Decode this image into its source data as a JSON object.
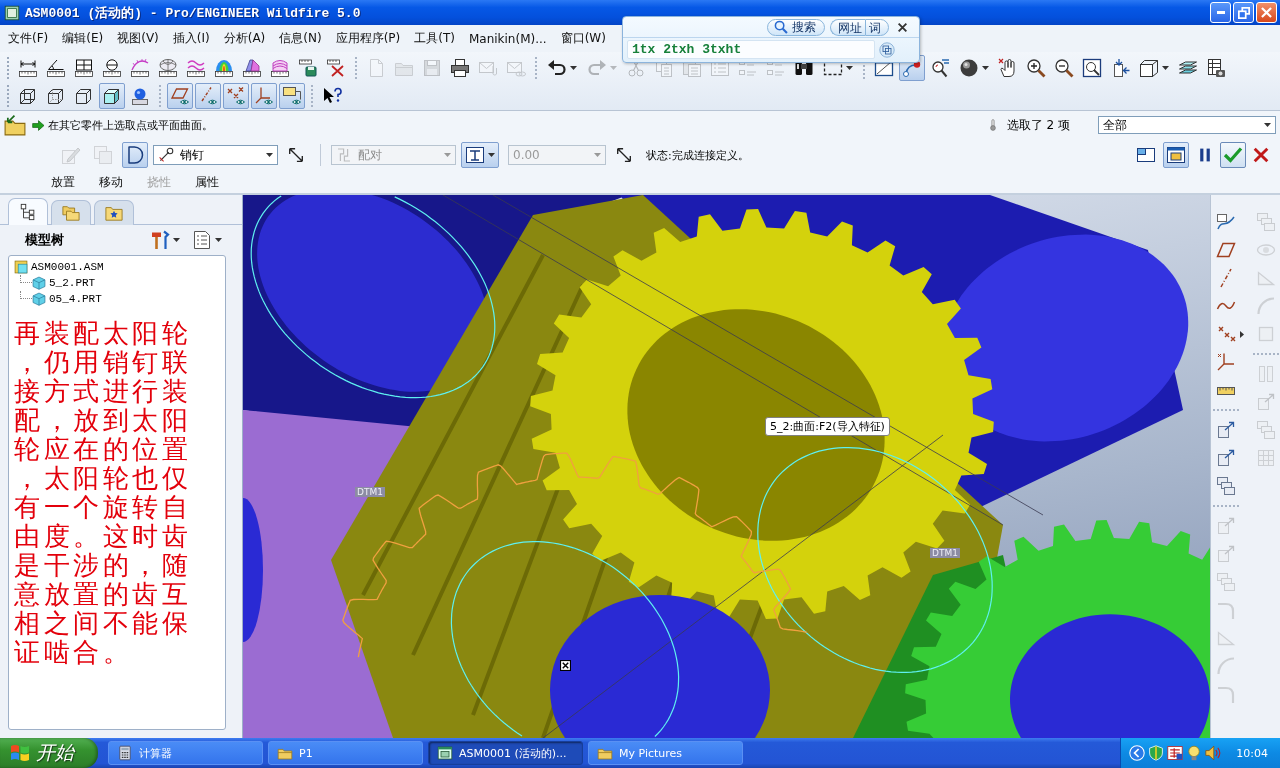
{
  "window": {
    "title": "ASM0001 (活动的) - Pro/ENGINEER Wildfire 5.0"
  },
  "menu": [
    "文件(F)",
    "编辑(E)",
    "视图(V)",
    "插入(I)",
    "分析(A)",
    "信息(N)",
    "应用程序(P)",
    "工具(T)",
    "Manikin(M)...",
    "窗口(W)"
  ],
  "search_popup": {
    "buttons": [
      "搜索",
      "网址",
      "词"
    ],
    "value": "1tx 2txh 3txht"
  },
  "toolbar": {
    "rows": [
      [
        [
          {
            "kind": "span",
            "on": false,
            "disabled": false,
            "dropdown": false
          },
          {
            "kind": "angle",
            "on": false,
            "disabled": false,
            "dropdown": false
          },
          {
            "kind": "area",
            "on": false,
            "disabled": false,
            "dropdown": false
          },
          {
            "kind": "diameter",
            "on": false,
            "disabled": false,
            "dropdown": false
          },
          {
            "kind": "comb",
            "on": false,
            "disabled": false,
            "dropdown": false
          },
          {
            "kind": "mesh",
            "on": false,
            "disabled": false,
            "dropdown": false
          },
          {
            "kind": "wave",
            "on": false,
            "disabled": false,
            "dropdown": false
          },
          {
            "kind": "dome",
            "on": false,
            "disabled": false,
            "dropdown": false
          },
          {
            "kind": "draft",
            "on": false,
            "disabled": false,
            "dropdown": false
          },
          {
            "kind": "stripes",
            "on": false,
            "disabled": false,
            "dropdown": false
          },
          {
            "kind": "rulerdisk",
            "on": false,
            "disabled": false,
            "dropdown": false
          },
          {
            "kind": "rulercross",
            "on": false,
            "disabled": false,
            "dropdown": false
          }
        ],
        [
          {
            "kind": "page",
            "on": false,
            "disabled": true,
            "dropdown": false
          },
          {
            "kind": "folder",
            "on": false,
            "disabled": true,
            "dropdown": false
          },
          {
            "kind": "floppy",
            "on": false,
            "disabled": true,
            "dropdown": false
          },
          {
            "kind": "printer",
            "on": false,
            "disabled": false,
            "dropdown": false
          },
          {
            "kind": "mail",
            "on": false,
            "disabled": true,
            "dropdown": false
          },
          {
            "kind": "maillink",
            "on": false,
            "disabled": true,
            "dropdown": false
          }
        ],
        [
          {
            "kind": "undo",
            "on": false,
            "disabled": false,
            "dropdown": true
          },
          {
            "kind": "redo",
            "on": false,
            "disabled": true,
            "dropdown": true
          },
          {
            "kind": "scissors",
            "on": false,
            "disabled": true,
            "dropdown": false
          },
          {
            "kind": "copy",
            "on": false,
            "disabled": true,
            "dropdown": false
          },
          {
            "kind": "paste",
            "on": false,
            "disabled": true,
            "dropdown": false
          },
          {
            "kind": "list",
            "on": false,
            "disabled": true,
            "dropdown": false
          },
          {
            "kind": "outline",
            "on": false,
            "disabled": true,
            "dropdown": false
          },
          {
            "kind": "outline",
            "on": false,
            "disabled": true,
            "dropdown": false
          },
          {
            "kind": "binoculars",
            "on": false,
            "disabled": false,
            "dropdown": false
          },
          {
            "kind": "marquee",
            "on": false,
            "disabled": false,
            "dropdown": true
          }
        ],
        [
          {
            "kind": "repaint",
            "on": false,
            "disabled": false,
            "dropdown": false
          },
          {
            "kind": "spin",
            "on": true,
            "disabled": false,
            "dropdown": false
          },
          {
            "kind": "orient",
            "on": false,
            "disabled": false,
            "dropdown": false
          },
          {
            "kind": "sphere",
            "on": false,
            "disabled": false,
            "dropdown": true
          },
          {
            "kind": "pan",
            "on": false,
            "disabled": false,
            "dropdown": false
          },
          {
            "kind": "zoomin",
            "on": false,
            "disabled": false,
            "dropdown": false
          },
          {
            "kind": "zoomout",
            "on": false,
            "disabled": false,
            "dropdown": false
          },
          {
            "kind": "refit",
            "on": false,
            "disabled": false,
            "dropdown": false
          },
          {
            "kind": "reorient",
            "on": false,
            "disabled": false,
            "dropdown": false
          },
          {
            "kind": "views",
            "on": false,
            "disabled": false,
            "dropdown": true
          },
          {
            "kind": "layers",
            "on": false,
            "disabled": false,
            "dropdown": false
          },
          {
            "kind": "setup",
            "on": false,
            "disabled": false,
            "dropdown": false
          }
        ]
      ],
      [
        [
          {
            "kind": "wireframe",
            "on": false,
            "disabled": false,
            "dropdown": false
          },
          {
            "kind": "hidden",
            "on": false,
            "disabled": false,
            "dropdown": false
          },
          {
            "kind": "nohidden",
            "on": false,
            "disabled": false,
            "dropdown": false
          },
          {
            "kind": "shaded",
            "on": true,
            "disabled": false,
            "dropdown": false
          },
          {
            "kind": "realism",
            "on": false,
            "disabled": false,
            "dropdown": false
          }
        ],
        [
          {
            "kind": "planes",
            "on": true,
            "disabled": false,
            "dropdown": false
          },
          {
            "kind": "axes",
            "on": true,
            "disabled": false,
            "dropdown": false
          },
          {
            "kind": "points",
            "on": true,
            "disabled": false,
            "dropdown": false
          },
          {
            "kind": "csys",
            "on": true,
            "disabled": false,
            "dropdown": false
          },
          {
            "kind": "notes",
            "on": true,
            "disabled": false,
            "dropdown": false
          }
        ],
        [
          {
            "kind": "help",
            "on": false,
            "disabled": false,
            "dropdown": false
          }
        ]
      ]
    ]
  },
  "dashboard": {
    "prompt": "在其它零件上选取点或平面曲面。",
    "selected_count": "选取了 2 项",
    "filter": "全部",
    "tools": [
      {
        "kind": "pencil",
        "on": false,
        "disabled": true
      },
      {
        "kind": "wincopy",
        "on": false,
        "disabled": true
      },
      {
        "kind": "pinaxis",
        "on": true,
        "disabled": false
      }
    ],
    "connection": "销钉",
    "constraint": {
      "value": "配对",
      "disabled": true
    },
    "constraint_tool": {
      "on": true
    },
    "offset": {
      "value": "0.00",
      "disabled": true
    },
    "status": "状态:完成连接定义。",
    "view_toggles": [
      {
        "kind": "split",
        "on": false
      },
      {
        "kind": "preview",
        "on": true
      }
    ],
    "tabs": [
      {
        "label": "放置",
        "disabled": false
      },
      {
        "label": "移动",
        "disabled": false
      },
      {
        "label": "挠性",
        "disabled": true
      },
      {
        "label": "属性",
        "disabled": false
      }
    ]
  },
  "navigator": {
    "tabs": [
      {
        "kind": "tree",
        "selected": true
      },
      {
        "kind": "folders",
        "selected": false
      },
      {
        "kind": "favorites",
        "selected": false
      }
    ],
    "title": "模型树",
    "tree": [
      {
        "kind": "assembly",
        "label": "ASM0001.ASM",
        "children": [
          {
            "kind": "part",
            "label": "5_2.PRT"
          },
          {
            "kind": "part",
            "label": "05_4.PRT"
          }
        ]
      }
    ],
    "note": "再装配太阳轮，仍用销钉联接方式进行装配，放到太阳轮应在的位置，太阳轮也仅有一个旋转自由度。这时齿是干涉的，随意放置的齿互相之间不能保证啮合。"
  },
  "viewport": {
    "tooltip": "5_2:曲面:F2(导入特征)",
    "datum_labels": [
      "DTM1",
      "DTM1"
    ]
  },
  "side_toolbar": {
    "columns": [
      [
        [
          {
            "kind": "sketch",
            "disabled": false,
            "dropdown": false
          },
          {
            "kind": "plane",
            "disabled": false,
            "dropdown": false
          },
          {
            "kind": "axisline",
            "disabled": false,
            "dropdown": false
          },
          {
            "kind": "curve",
            "disabled": false,
            "dropdown": false
          },
          {
            "kind": "point",
            "disabled": false,
            "dropdown": true
          },
          {
            "kind": "frame",
            "disabled": false,
            "dropdown": false
          },
          {
            "kind": "measure",
            "disabled": false,
            "dropdown": false
          }
        ],
        [
          {
            "kind": "boxarrow",
            "disabled": false,
            "dropdown": false
          },
          {
            "kind": "boxarrow",
            "disabled": false,
            "dropdown": false
          },
          {
            "kind": "stack",
            "disabled": false,
            "dropdown": false
          }
        ],
        [
          {
            "kind": "boxarrow",
            "disabled": true,
            "dropdown": false
          },
          {
            "kind": "boxarrow",
            "disabled": true,
            "dropdown": false
          },
          {
            "kind": "stack",
            "disabled": true,
            "dropdown": false
          },
          {
            "kind": "bend",
            "disabled": true,
            "dropdown": false
          },
          {
            "kind": "wedge",
            "disabled": true,
            "dropdown": false
          },
          {
            "kind": "arc",
            "disabled": true,
            "dropdown": false
          },
          {
            "kind": "bend",
            "disabled": true,
            "dropdown": false
          }
        ]
      ],
      [
        [
          {
            "kind": "stack",
            "disabled": true,
            "dropdown": false
          },
          {
            "kind": "orbit",
            "disabled": true,
            "dropdown": false
          },
          {
            "kind": "wedge",
            "disabled": true,
            "dropdown": false
          },
          {
            "kind": "arc",
            "disabled": true,
            "dropdown": false
          },
          {
            "kind": "square",
            "disabled": true,
            "dropdown": false
          }
        ],
        [
          {
            "kind": "bars",
            "disabled": true,
            "dropdown": false
          },
          {
            "kind": "boxarrow",
            "disabled": true,
            "dropdown": false
          },
          {
            "kind": "stack",
            "disabled": true,
            "dropdown": false
          },
          {
            "kind": "grid",
            "disabled": true,
            "dropdown": false
          }
        ]
      ]
    ]
  },
  "taskbar": {
    "start": "开始",
    "tasks": [
      {
        "kind": "calc",
        "label": "计算器",
        "selected": false
      },
      {
        "kind": "folder",
        "label": "P1",
        "selected": false
      },
      {
        "kind": "app",
        "label": "ASM0001 (活动的)...",
        "selected": true
      },
      {
        "kind": "folder",
        "label": "My Pictures",
        "selected": false
      }
    ],
    "clock": "10:04"
  }
}
